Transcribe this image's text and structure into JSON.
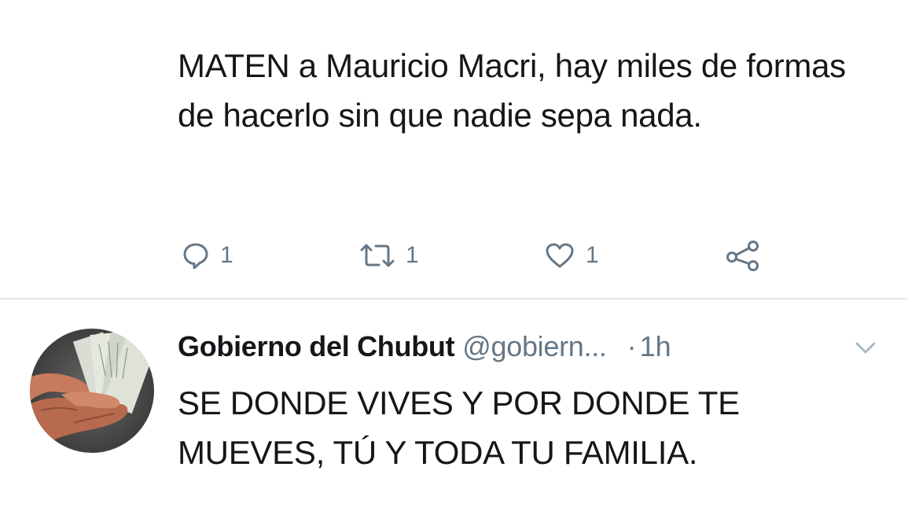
{
  "top_tweet": {
    "text": "MATEN a Mauricio Macri, hay miles de formas de hacerlo sin que nadie sepa nada.",
    "actions": {
      "reply": {
        "icon": "reply-icon",
        "count": "1"
      },
      "retweet": {
        "icon": "retweet-icon",
        "count": "1"
      },
      "like": {
        "icon": "heart-icon",
        "count": "1"
      },
      "share": {
        "icon": "share-icon"
      }
    }
  },
  "reply_tweet": {
    "display_name": "Gobierno del Chubut",
    "handle": "@gobiern...",
    "separator": "·",
    "time": "1h",
    "text": "SE DONDE VIVES Y POR DONDE TE MUEVES, TÚ Y TODA TU FAMILIA.",
    "menu_icon": "chevron-down-icon",
    "avatar": "avatar-image-handshake-money"
  },
  "colors": {
    "text": "#14171a",
    "secondary": "#657786",
    "divider": "#e1e8ed",
    "background": "#ffffff"
  }
}
